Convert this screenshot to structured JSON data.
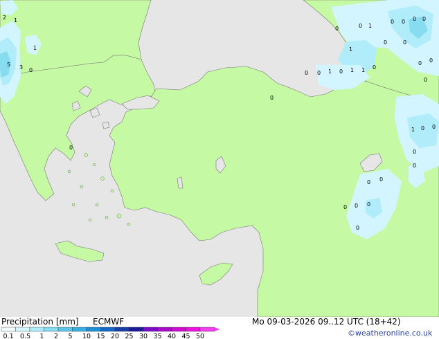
{
  "title": "Precipitation [mm]",
  "model": "ECMWF",
  "datetime": "Mo 09-03-2026 09..12 UTC (18+42)",
  "credit": "©weatheronline.co.uk",
  "legend": {
    "ticks": [
      "0.1",
      "0.5",
      "1",
      "2",
      "5",
      "10",
      "15",
      "20",
      "25",
      "30",
      "35",
      "40",
      "45",
      "50"
    ],
    "colors": [
      "#f0fbff",
      "#d2f5ff",
      "#b0ecfa",
      "#88dcef",
      "#5cc6e6",
      "#3aaee0",
      "#1e90d8",
      "#1668c8",
      "#1a3ea8",
      "#1c1c98",
      "#7a0cc8",
      "#a80cc8",
      "#d00cd0",
      "#f010e0",
      "#f040f0"
    ]
  },
  "map_labels": [
    {
      "text": "2"
    },
    {
      "text": "1"
    },
    {
      "text": "1"
    },
    {
      "text": "5"
    },
    {
      "text": "3"
    },
    {
      "text": "0"
    },
    {
      "text": "0"
    },
    {
      "text": "0"
    },
    {
      "text": "1"
    },
    {
      "text": "0"
    },
    {
      "text": "0"
    },
    {
      "text": "0"
    },
    {
      "text": "0"
    },
    {
      "text": "0"
    },
    {
      "text": "0"
    },
    {
      "text": "1"
    },
    {
      "text": "0"
    },
    {
      "text": "0"
    },
    {
      "text": "0"
    },
    {
      "text": "0"
    },
    {
      "text": "1"
    },
    {
      "text": "0"
    },
    {
      "text": "1"
    },
    {
      "text": "1"
    },
    {
      "text": "0"
    },
    {
      "text": "0"
    },
    {
      "text": "0"
    },
    {
      "text": "1"
    },
    {
      "text": "0"
    },
    {
      "text": "0"
    },
    {
      "text": "0"
    },
    {
      "text": "0"
    },
    {
      "text": "0"
    },
    {
      "text": "0"
    },
    {
      "text": "0"
    },
    {
      "text": "0"
    },
    {
      "text": "0"
    },
    {
      "text": "0"
    },
    {
      "text": "0"
    }
  ]
}
